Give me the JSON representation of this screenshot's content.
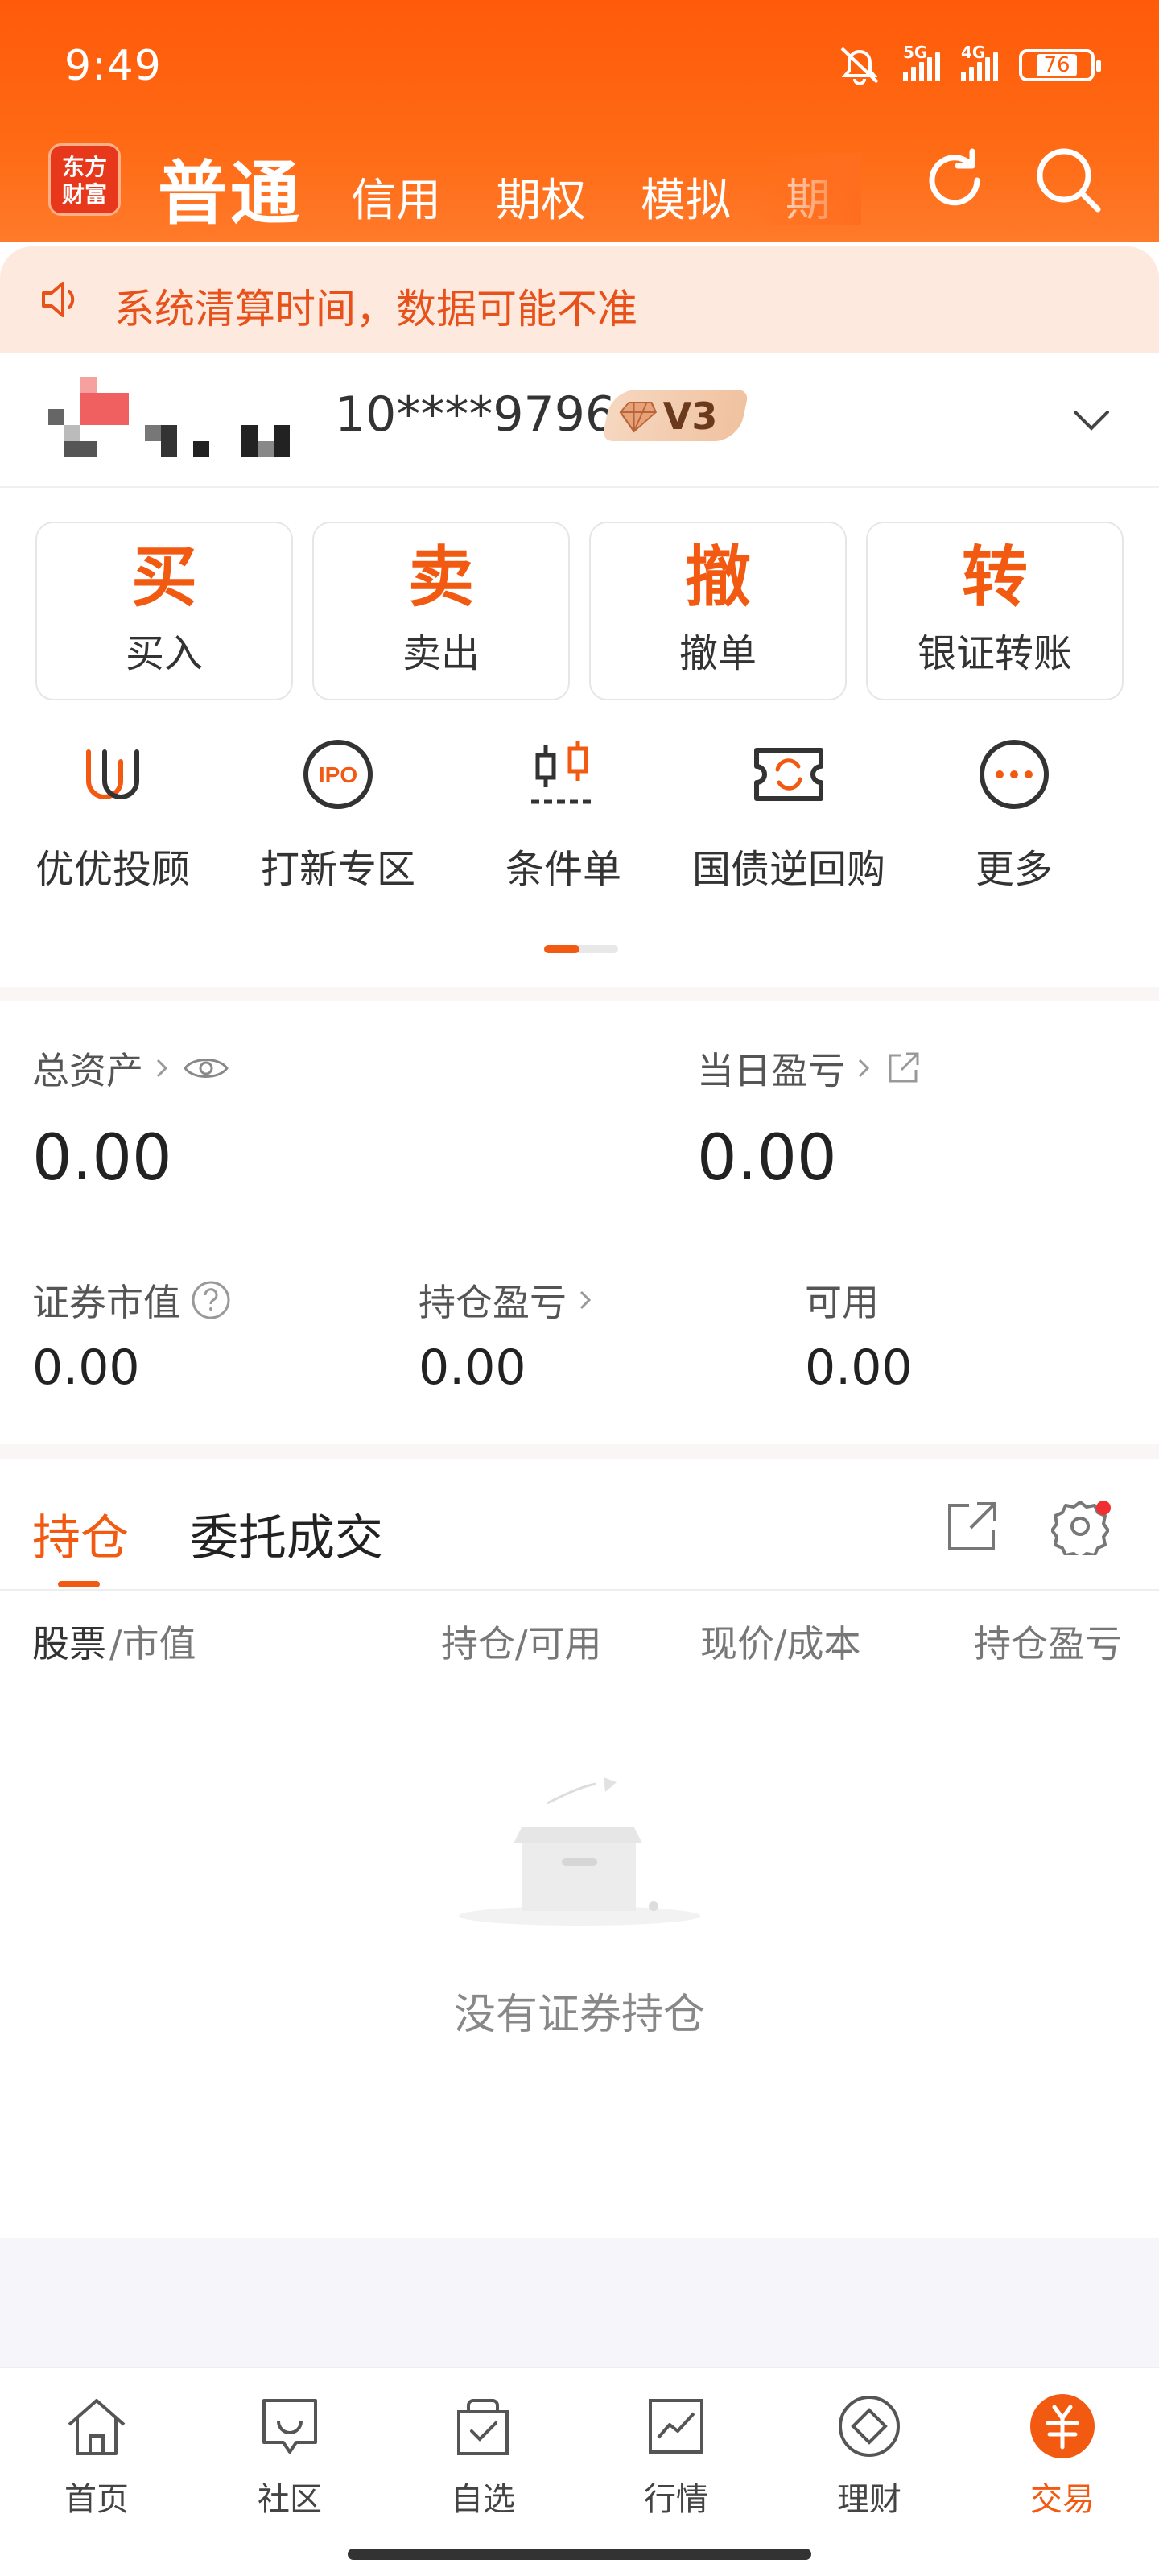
{
  "status_bar": {
    "time": "9:49",
    "net1": "5G",
    "net2": "4G",
    "battery": "76"
  },
  "nav": {
    "logo_line1": "东方",
    "logo_line2": "财富",
    "tabs": [
      "普通",
      "信用",
      "期权",
      "模拟",
      "期"
    ]
  },
  "notice": {
    "text": "系统清算时间，数据可能不准"
  },
  "account": {
    "number": "10****9796",
    "level": "V3"
  },
  "actions": [
    {
      "big": "买",
      "label": "买入"
    },
    {
      "big": "卖",
      "label": "卖出"
    },
    {
      "big": "撤",
      "label": "撤单"
    },
    {
      "big": "转",
      "label": "银证转账"
    }
  ],
  "quick": [
    {
      "label": "优优投顾",
      "icon": "advisor-icon"
    },
    {
      "label": "打新专区",
      "icon": "ipo-icon"
    },
    {
      "label": "条件单",
      "icon": "condition-order-icon"
    },
    {
      "label": "国债逆回购",
      "icon": "repo-icon"
    },
    {
      "label": "更多",
      "icon": "more-icon"
    }
  ],
  "assets": {
    "total_label": "总资产",
    "total_value": "0.00",
    "daily_label": "当日盈亏",
    "daily_value": "0.00",
    "market_label": "证券市值",
    "market_value": "0.00",
    "holding_pl_label": "持仓盈亏",
    "holding_pl_value": "0.00",
    "available_label": "可用",
    "available_value": "0.00"
  },
  "positions": {
    "tab_holdings": "持仓",
    "tab_orders": "委托成交",
    "columns": [
      "股票",
      "/市值",
      "持仓/可用",
      "现价/成本",
      "持仓盈亏"
    ],
    "empty_text": "没有证券持仓"
  },
  "bottom_nav": [
    {
      "label": "首页",
      "icon": "home-icon"
    },
    {
      "label": "社区",
      "icon": "community-icon"
    },
    {
      "label": "自选",
      "icon": "watchlist-icon"
    },
    {
      "label": "行情",
      "icon": "market-icon"
    },
    {
      "label": "理财",
      "icon": "wealth-icon"
    },
    {
      "label": "交易",
      "icon": "trade-icon"
    }
  ],
  "colors": {
    "accent": "#f25a12",
    "header": "#ff5a0a",
    "notice_bg": "#fde9dd"
  }
}
